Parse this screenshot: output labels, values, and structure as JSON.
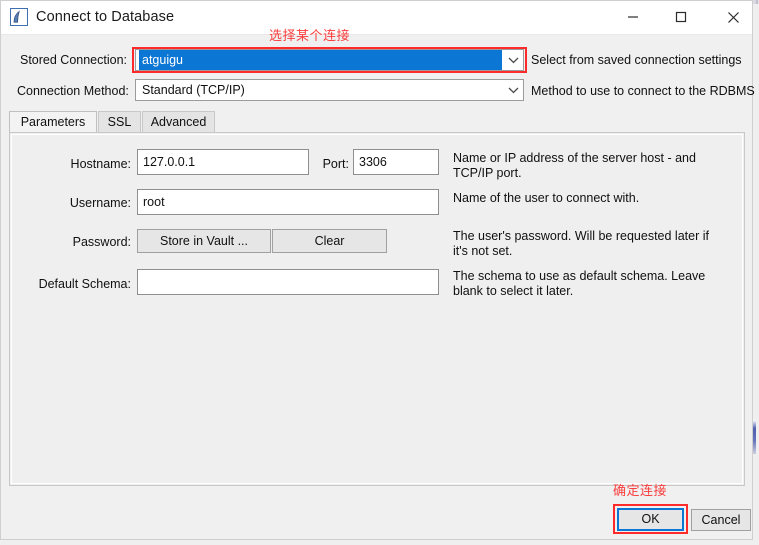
{
  "window": {
    "title": "Connect to Database",
    "icon": "mysql-workbench-icon",
    "controls": {
      "minimize": "minimize-icon",
      "maximize": "maximize-icon",
      "close": "close-icon"
    }
  },
  "annotations": {
    "top": "选择某个连接",
    "ok": "确定连接",
    "color": "#ff2a2a"
  },
  "top_form": {
    "stored_connection": {
      "label": "Stored Connection:",
      "value": "atguigu",
      "hint": "Select from saved connection settings",
      "selected_bg": "#0c76d4"
    },
    "connection_method": {
      "label": "Connection Method:",
      "value": "Standard (TCP/IP)",
      "hint": "Method to use to connect to the RDBMS"
    }
  },
  "tabs": [
    {
      "label": "Parameters",
      "active": true
    },
    {
      "label": "SSL",
      "active": false
    },
    {
      "label": "Advanced",
      "active": false
    }
  ],
  "parameters": {
    "hostname": {
      "label": "Hostname:",
      "value": "127.0.0.1",
      "hint": "Name or IP address of the server host - and TCP/IP port."
    },
    "port": {
      "label": "Port:",
      "value": "3306"
    },
    "username": {
      "label": "Username:",
      "value": "root",
      "hint": "Name of the user to connect with."
    },
    "password": {
      "label": "Password:",
      "store_button": "Store in Vault ...",
      "clear_button": "Clear",
      "hint": "The user's password. Will be requested later if it's not set."
    },
    "default_schema": {
      "label": "Default Schema:",
      "value": "",
      "placeholder": "",
      "hint": "The schema to use as default schema. Leave blank to select it later."
    }
  },
  "footer": {
    "ok": "OK",
    "cancel": "Cancel",
    "focus_color": "#0c76d4"
  }
}
